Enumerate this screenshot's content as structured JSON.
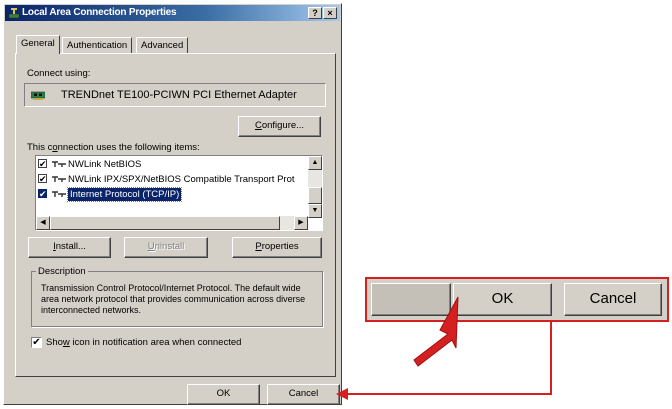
{
  "window": {
    "title": "Local Area Connection Properties",
    "help_label": "?",
    "close_label": "×"
  },
  "tabs": [
    {
      "label": "General",
      "active": true
    },
    {
      "label": "Authentication",
      "active": false
    },
    {
      "label": "Advanced",
      "active": false
    }
  ],
  "connect_using": {
    "label": "Connect using:",
    "adapter": "TRENDnet TE100-PCIWN PCI Ethernet Adapter",
    "configure": {
      "pre": "",
      "key": "C",
      "post": "onfigure..."
    }
  },
  "items_section": {
    "label": {
      "pre": "This c",
      "key": "o",
      "post": "nnection uses the following items:"
    },
    "items": [
      {
        "label": "NWLink NetBIOS",
        "checked": true,
        "selected": false
      },
      {
        "label": "NWLink IPX/SPX/NetBIOS Compatible Transport Prot",
        "checked": true,
        "selected": false
      },
      {
        "label": "Internet Protocol (TCP/IP)",
        "checked": true,
        "selected": true
      }
    ]
  },
  "item_buttons": {
    "install": {
      "pre": "",
      "key": "I",
      "post": "nstall..."
    },
    "uninstall": {
      "pre": "",
      "key": "U",
      "post": "ninstall"
    },
    "properties": {
      "pre": "",
      "key": "P",
      "post": "roperties"
    }
  },
  "description": {
    "title": "Description",
    "text": "Transmission Control Protocol/Internet Protocol. The default wide area network protocol that provides communication across diverse interconnected networks."
  },
  "show_icon": {
    "pre": "Sho",
    "key": "w",
    "post": " icon in notification area when connected",
    "checked": true
  },
  "footer": {
    "ok": "OK",
    "cancel": "Cancel"
  },
  "zoom_callout": {
    "ok": "OK",
    "cancel": "Cancel"
  },
  "colors": {
    "annotation": "#d42020",
    "title_bar": "#0a246a",
    "dialog_face": "#d4d0c8"
  }
}
